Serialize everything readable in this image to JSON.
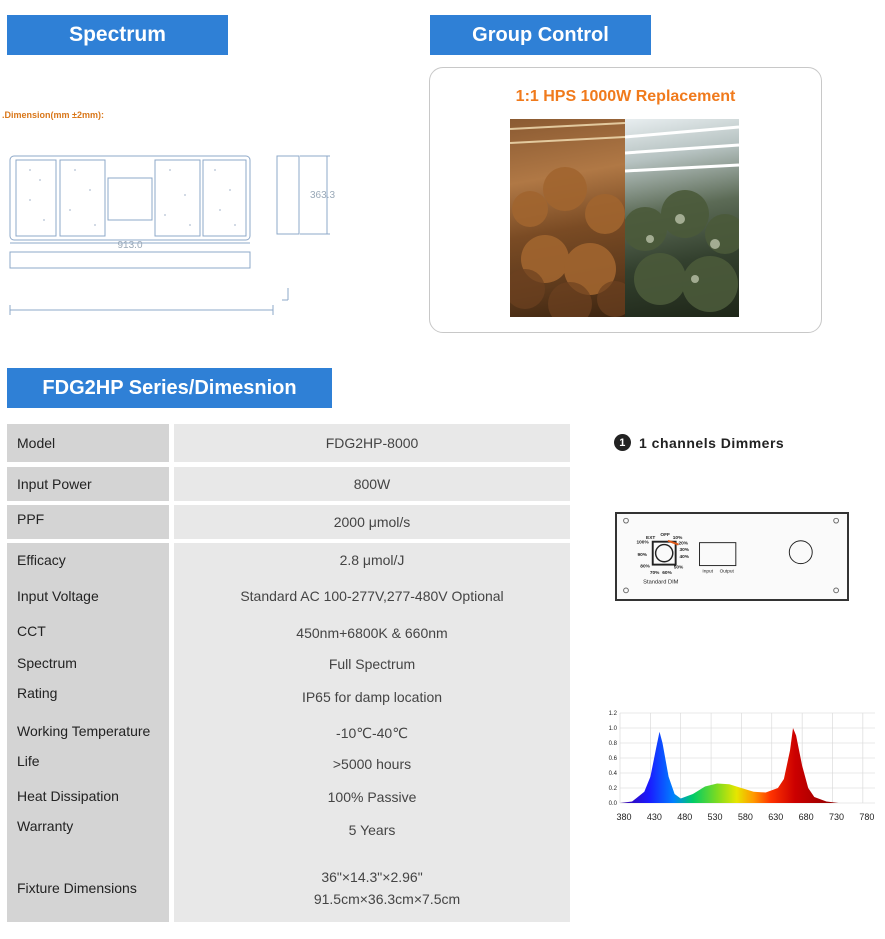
{
  "banners": {
    "spectrum": "Spectrum",
    "group_control": "Group Control",
    "series": "FDG2HP Series/Dimesnion"
  },
  "dimension": {
    "caption": ".Dimension(mm ±2mm):",
    "width_label": "913.0",
    "height_label": "363.3"
  },
  "group_card": {
    "title": "1:1 HPS 1000W Replacement"
  },
  "table": {
    "model_label": "Model",
    "model_value": "FDG2HP-8000",
    "power_label": "Input Power",
    "power_value": "800W",
    "ppf_label": "PPF",
    "ppf_value": "2000 μmol/s",
    "efficacy_label": "Efficacy",
    "efficacy_value": "2.8 μmol/J",
    "voltage_label": "Input Voltage",
    "voltage_value": "Standard AC  100-277V,277-480V Optional",
    "cct_label": "CCT",
    "cct_value": "450nm+6800K & 660nm",
    "spectrum_label": "Spectrum",
    "spectrum_value": "Full Spectrum",
    "rating_label": "Rating",
    "rating_value": "IP65 for damp location",
    "temp_label": "Working Temperature",
    "temp_value": "-10℃-40℃",
    "life_label": "Life",
    "life_value": ">5000 hours",
    "heat_label": "Heat Dissipation",
    "heat_value": "100% Passive",
    "warranty_label": "Warranty",
    "warranty_value": "5 Years",
    "dims_label": "Fixture Dimensions",
    "dims_value_1": "36\"×14.3\"×2.96\"",
    "dims_value_2": "91.5cm×36.3cm×7.5cm"
  },
  "dimmer": {
    "badge": "1",
    "title": "1 channels Dimmers",
    "knob_labels": [
      "EXT",
      "OFF",
      "10%",
      "20%",
      "30%",
      "100%",
      "40%",
      "90%",
      "50%",
      "80%",
      "70%",
      "60%"
    ],
    "input_label": "Input",
    "output_label": "Output",
    "standard_dim": "Standard DIM"
  },
  "chart_data": {
    "type": "area",
    "title": "",
    "xlabel": "",
    "ylabel": "",
    "x_ticks": [
      "380",
      "430",
      "480",
      "530",
      "580",
      "630",
      "680",
      "730",
      "780"
    ],
    "y_ticks": [
      "0.0",
      "0.2",
      "0.4",
      "0.6",
      "0.8",
      "1.0",
      "1.2"
    ],
    "xlim": [
      380,
      800
    ],
    "ylim": [
      0,
      1.2
    ],
    "x": [
      380,
      400,
      420,
      430,
      440,
      445,
      450,
      460,
      470,
      480,
      500,
      520,
      540,
      560,
      580,
      600,
      620,
      640,
      650,
      660,
      665,
      670,
      680,
      690,
      700,
      720,
      740,
      780
    ],
    "values": [
      0.0,
      0.02,
      0.15,
      0.35,
      0.75,
      0.95,
      0.8,
      0.35,
      0.12,
      0.06,
      0.12,
      0.22,
      0.26,
      0.25,
      0.2,
      0.15,
      0.14,
      0.2,
      0.32,
      0.7,
      1.0,
      0.9,
      0.5,
      0.2,
      0.08,
      0.02,
      0.0,
      0.0
    ],
    "grid": true
  }
}
